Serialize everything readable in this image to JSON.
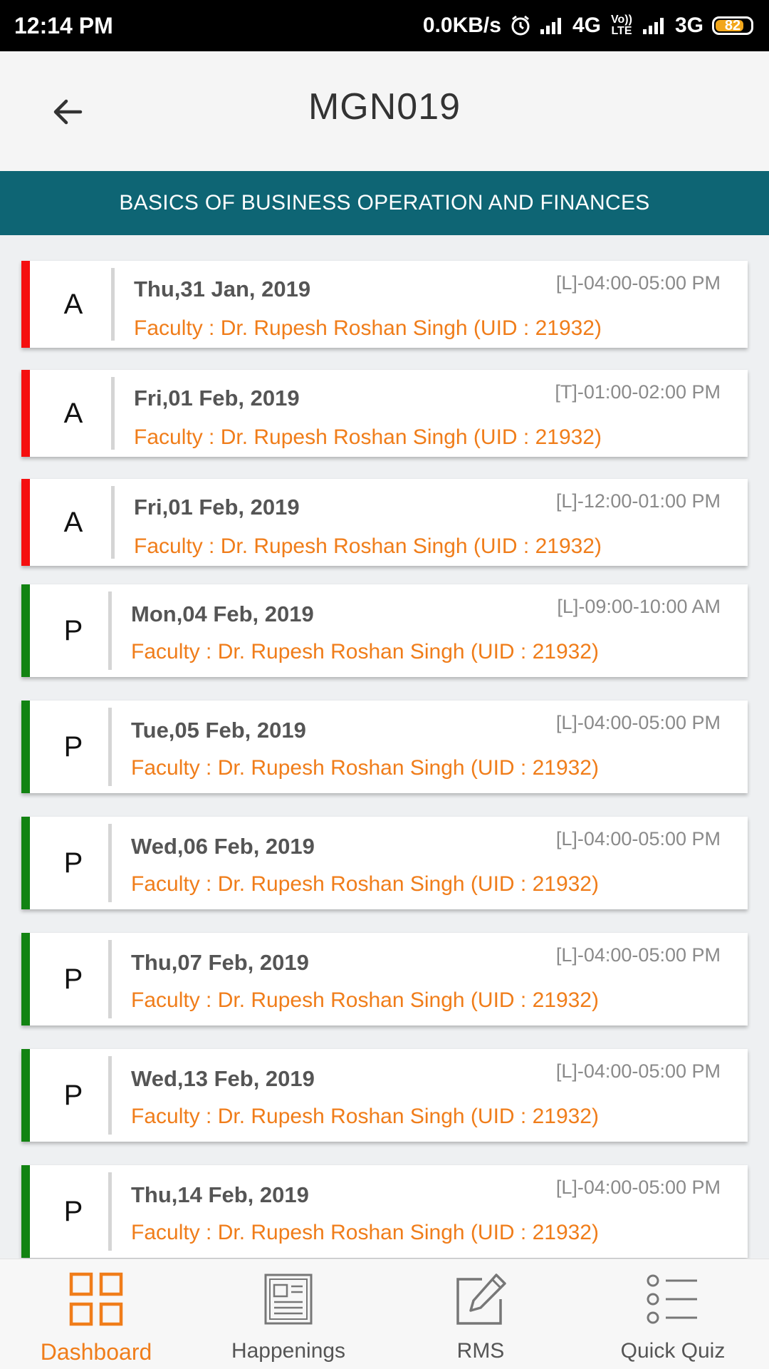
{
  "status_bar": {
    "time": "12:14 PM",
    "speed": "0.0KB/s",
    "net1": "4G",
    "volte": "Vo)) LTE",
    "net2": "3G",
    "battery": "82",
    "battery_level": 0.82
  },
  "app_bar": {
    "title": "MGN019",
    "back_icon": "arrow-left-icon"
  },
  "course_banner": {
    "title": "BASICS OF BUSINESS OPERATION AND FINANCES"
  },
  "colors": {
    "absent": "#f50f0f",
    "present": "#128312",
    "faculty_text": "#f07d1a",
    "banner": "#0e6574"
  },
  "attendance": [
    {
      "status": "A",
      "date": "Thu,31 Jan, 2019",
      "time": "[L]-04:00-05:00 PM",
      "faculty": "Faculty : Dr. Rupesh Roshan Singh (UID : 21932)"
    },
    {
      "status": "A",
      "date": "Fri,01 Feb, 2019",
      "time": "[T]-01:00-02:00 PM",
      "faculty": "Faculty : Dr. Rupesh Roshan Singh (UID : 21932)"
    },
    {
      "status": "A",
      "date": "Fri,01 Feb, 2019",
      "time": "[L]-12:00-01:00 PM",
      "faculty": "Faculty : Dr. Rupesh Roshan Singh (UID : 21932)"
    },
    {
      "status": "P",
      "date": "Mon,04 Feb, 2019",
      "time": "[L]-09:00-10:00 AM",
      "faculty": "Faculty : Dr. Rupesh Roshan Singh (UID : 21932)"
    },
    {
      "status": "P",
      "date": "Tue,05 Feb, 2019",
      "time": "[L]-04:00-05:00 PM",
      "faculty": "Faculty : Dr. Rupesh Roshan Singh (UID : 21932)"
    },
    {
      "status": "P",
      "date": "Wed,06 Feb, 2019",
      "time": "[L]-04:00-05:00 PM",
      "faculty": "Faculty : Dr. Rupesh Roshan Singh (UID : 21932)"
    },
    {
      "status": "P",
      "date": "Thu,07 Feb, 2019",
      "time": "[L]-04:00-05:00 PM",
      "faculty": "Faculty : Dr. Rupesh Roshan Singh (UID : 21932)"
    },
    {
      "status": "P",
      "date": "Wed,13 Feb, 2019",
      "time": "[L]-04:00-05:00 PM",
      "faculty": "Faculty : Dr. Rupesh Roshan Singh (UID : 21932)"
    },
    {
      "status": "P",
      "date": "Thu,14 Feb, 2019",
      "time": "[L]-04:00-05:00 PM",
      "faculty": "Faculty : Dr. Rupesh Roshan Singh (UID : 21932)"
    }
  ],
  "bottom_nav": [
    {
      "label": "Dashboard",
      "icon": "dashboard-grid-icon",
      "active": true
    },
    {
      "label": "Happenings",
      "icon": "newspaper-icon",
      "active": false
    },
    {
      "label": "RMS",
      "icon": "edit-icon",
      "active": false
    },
    {
      "label": "Quick Quiz",
      "icon": "list-icon",
      "active": false
    }
  ]
}
